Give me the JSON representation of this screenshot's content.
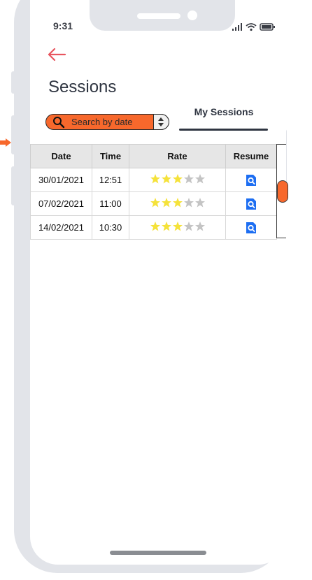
{
  "status_bar": {
    "time": "9:31",
    "icons": [
      "signal-icon",
      "wifi-icon",
      "battery-icon"
    ]
  },
  "header": {
    "back_icon": "left-arrow-icon",
    "title": "Sessions"
  },
  "search": {
    "placeholder": "Search by date",
    "value": "",
    "icon": "search-icon"
  },
  "tabs": [
    {
      "label": "My Sessions",
      "active": true
    }
  ],
  "table": {
    "columns": [
      "Date",
      "Time",
      "Rate",
      "Resume"
    ],
    "rows": [
      {
        "date": "30/01/2021",
        "time": "12:51",
        "rating": 3,
        "max_rating": 5,
        "resume_icon": "document-search-icon"
      },
      {
        "date": "07/02/2021",
        "time": "11:00",
        "rating": 3,
        "max_rating": 5,
        "resume_icon": "document-search-icon"
      },
      {
        "date": "14/02/2021",
        "time": "10:30",
        "rating": 3,
        "max_rating": 5,
        "resume_icon": "document-search-icon"
      }
    ]
  },
  "colors": {
    "accent": "#f7682c",
    "back_arrow": "#e8555f",
    "star_filled": "#f5e23a",
    "star_empty": "#c4c4c4",
    "resume_icon": "#1d6ef2",
    "phone_frame": "#e2e4e9",
    "title_text": "#2f3541"
  }
}
